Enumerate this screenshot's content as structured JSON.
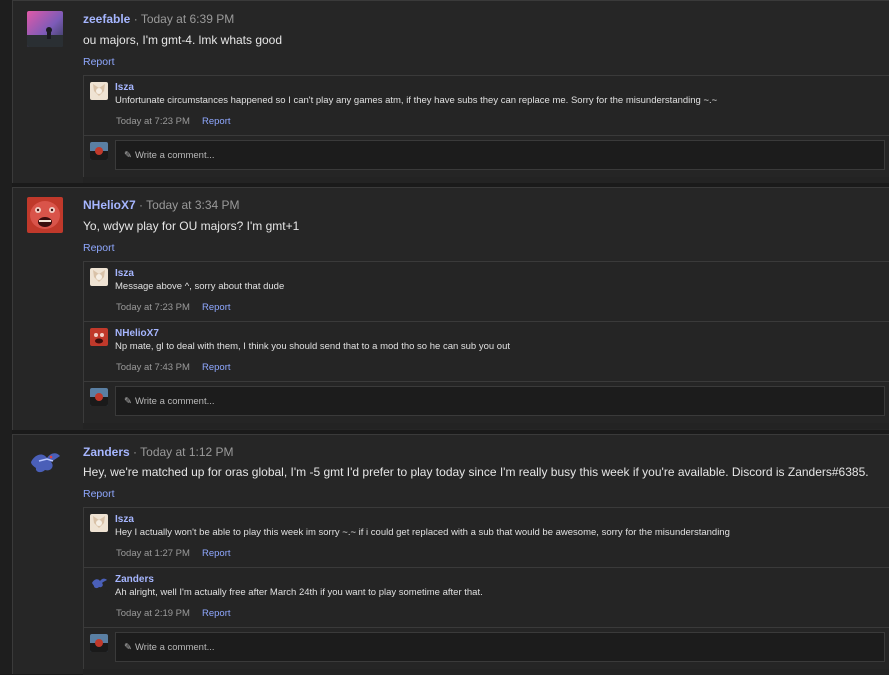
{
  "posts": [
    {
      "author": "zeefable",
      "time": "Today at 6:39 PM",
      "body": "ou majors, I'm gmt-4. lmk whats good",
      "report": "Report",
      "comments": [
        {
          "author": "Isza",
          "text": "Unfortunate circumstances happened so I can't play any games atm, if they have subs they can replace me. Sorry for the misunderstanding ~.~",
          "time": "Today at 7:23 PM",
          "report": "Report"
        }
      ],
      "write_placeholder": "Write a comment..."
    },
    {
      "author": "NHelioX7",
      "time": "Today at 3:34 PM",
      "body": "Yo, wdyw play for OU majors? I'm gmt+1",
      "report": "Report",
      "comments": [
        {
          "author": "Isza",
          "text": "Message above ^, sorry about that dude",
          "time": "Today at 7:23 PM",
          "report": "Report"
        },
        {
          "author": "NHelioX7",
          "text": "Np mate, gl to deal with them, I think you should send that to a mod tho so he can sub you out",
          "time": "Today at 7:43 PM",
          "report": "Report"
        }
      ],
      "write_placeholder": "Write a comment..."
    },
    {
      "author": "Zanders",
      "time": "Today at 1:12 PM",
      "body": "Hey, we're matched up for oras global, I'm -5 gmt I'd prefer to play today since I'm really busy this week if you're available. Discord is Zanders#6385.",
      "report": "Report",
      "comments": [
        {
          "author": "Isza",
          "text": "Hey I actually won't be able to play this week im sorry ~.~ if i could get replaced with a sub that would be awesome, sorry for the misunderstanding",
          "time": "Today at 1:27 PM",
          "report": "Report"
        },
        {
          "author": "Zanders",
          "text": "Ah alright, well I'm actually free after March 24th if you want to play sometime after that.",
          "time": "Today at 2:19 PM",
          "report": "Report"
        }
      ],
      "write_placeholder": "Write a comment..."
    }
  ],
  "separator": " · "
}
